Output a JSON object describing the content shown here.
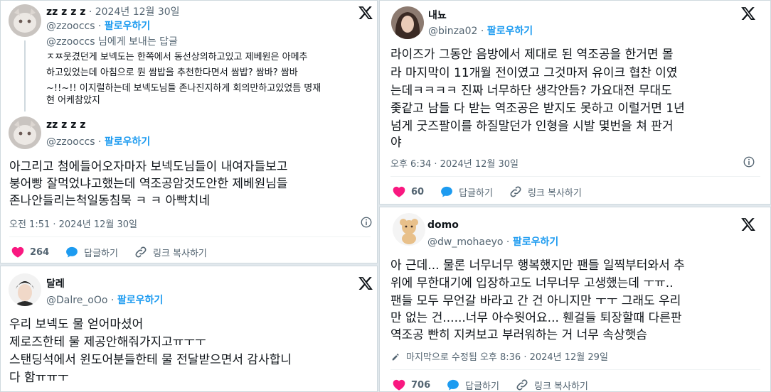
{
  "follow_label": "팔로우하기",
  "reply_label": "답글하기",
  "copy_label": "링크 복사하기",
  "colors": {
    "like": "#f91880",
    "follow": "#1d9bf0",
    "reply": "#1d9bf0",
    "muted": "#536471"
  },
  "card1": {
    "reply_tweet": {
      "name": "zz z z z",
      "date": "2024년 12월 30일",
      "handle": "@zzooccs",
      "reply_to": "@zzooccs 님에게 보내는 답글",
      "lines": [
        "ㅈㅉ웃겼던게 보넥도는 한쪽에서 동선상의하고있고 제베원은 아메추",
        "하고있었는데 아침으로 뭔 쌈밥을 추천한다면서 쌈밥? 쌈바? 쌈바",
        "~!!~!! 이지럴하는데 보넥도님들 존나진지하게 회의만하고있었듬 명재",
        "현 어케참았지"
      ]
    },
    "main_tweet": {
      "name": "zz z z z",
      "handle": "@zzooccs",
      "lines": [
        "아그리고 첨에들어오자마자 보넥도님들이 내여자들보고",
        "붕어빵 잘먹었냐고했는데 역조공암것도안한 제베원님들",
        "존나안들리는척일동침묵 ㅋ ㅋ 아빡치네"
      ],
      "timestamp": "오전 1:51 · 2024년 12월 30일",
      "likes": "264"
    }
  },
  "card2": {
    "name": "달레",
    "handle": "@Dalre_oOo",
    "lines": [
      "우리 보넥도 물 얻어마셨어",
      "제로즈한테 물 제공안해줘가지고ㅠㅜㅜ",
      "스탠딩석에서 윈도어분들한테 물 전달받으면서 감사합니",
      "다 함ㅠㅠㅜ"
    ]
  },
  "card3": {
    "name": "내뇨",
    "handle": "@binza02",
    "lines": [
      "라이즈가 그동안 음방에서 제대로 된 역조공을 한거면 몰",
      "라 마지막이 11개월 전이였고 그것마저 유이크 협찬 이였",
      "는데ㅋㅋㅋㅋ 진짜 너무하단 생각안듬? 가요대전 무대도",
      "좇같고 남들 다 받는 역조공은 받지도 못하고 이럴거면 1년",
      "넘게 굿즈팔이를 하질말던가 인형을 시발 몇번을 쳐 판거",
      "야"
    ],
    "timestamp": "오후 6:34 · 2024년 12월 30일",
    "likes": "60"
  },
  "card4": {
    "name": "domo",
    "handle": "@dw_mohaeyo",
    "lines": [
      "아 근데... 물론 너무너무 행복했지만 팬들 일찍부터와서 추",
      "위에 무한대기에 입장하고도 너무너무 고생했는데 ㅜㅠ..",
      "팬들 모두 무언갈 바라고 간 건 아니지만 ㅜㅜ 그래도 우리",
      "만 없는 건......너무 아수웟어요... 휀걸들 퇴장할때 다른판",
      "역조공 빤히 지켜보고 부러워하는 거 너무 속상햇슴"
    ],
    "edited": "마지막으로 수정됨 오후 8:36 · 2024년 12월 29일",
    "likes": "706"
  }
}
